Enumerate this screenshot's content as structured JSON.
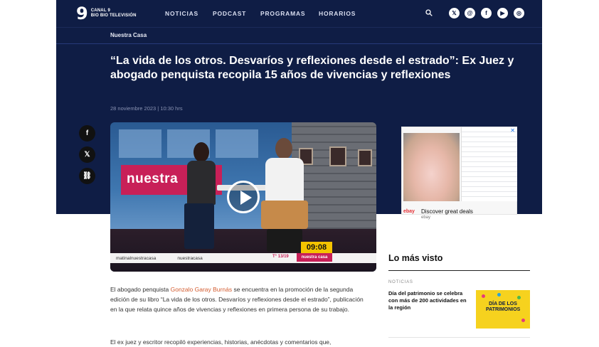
{
  "header": {
    "logo_number": "9",
    "logo_line1": "CANAL 9",
    "logo_line2": "BIO BIO TELEVISIÓN",
    "nav": [
      "NOTICIAS",
      "PODCAST",
      "PROGRAMAS",
      "HORARIOS"
    ],
    "social_icons": [
      "x-icon",
      "threads-icon",
      "facebook-icon",
      "youtube-icon",
      "instagram-icon"
    ]
  },
  "article": {
    "section": "Nuestra Casa",
    "headline": "“La vida de los otros. Desvaríos y reflexiones desde el estrado”: Ex Juez y abogado penquista recopila 15 años de vivencias y reflexiones",
    "date": "28 noviembre 2023 | 10:30 hrs",
    "paragraph1_pre": "El abogado penquista ",
    "paragraph1_link": "Gonzalo Garay Burnás",
    "paragraph1_post": " se encuentra en la promoción de la segunda edición de su libro “La vida de los otros. Desvaríos y reflexiones desde el estrado”, publicación en la que relata quince años de vivencias y reflexiones en primera persona de su trabajo.",
    "paragraph2": "El ex juez y escritor recopiló experiencias, historias, anécdotas y comentarios que,"
  },
  "video": {
    "brand_text": "nuestra",
    "handle_instagram": "matinalnuestracasa",
    "handle_facebook": "nuestracasa",
    "temperature": "T° 13/19",
    "clock": "09:08",
    "show_name": "nuestra casa"
  },
  "share": [
    "facebook-icon",
    "x-icon",
    "link-icon"
  ],
  "ad": {
    "brand": "ebay",
    "text": "Discover great deals",
    "sub": "ebay"
  },
  "sidebar": {
    "title": "Lo más visto",
    "category": "NOTICIAS",
    "item_title": "Día del patrimonio se celebra con más de 200 actividades en la región",
    "thumb_text": "DÍA DE LOS PATRIMONIOS"
  },
  "colors": {
    "header_bg": "#0f1d45",
    "accent": "#c82058",
    "link": "#d35b2f"
  }
}
